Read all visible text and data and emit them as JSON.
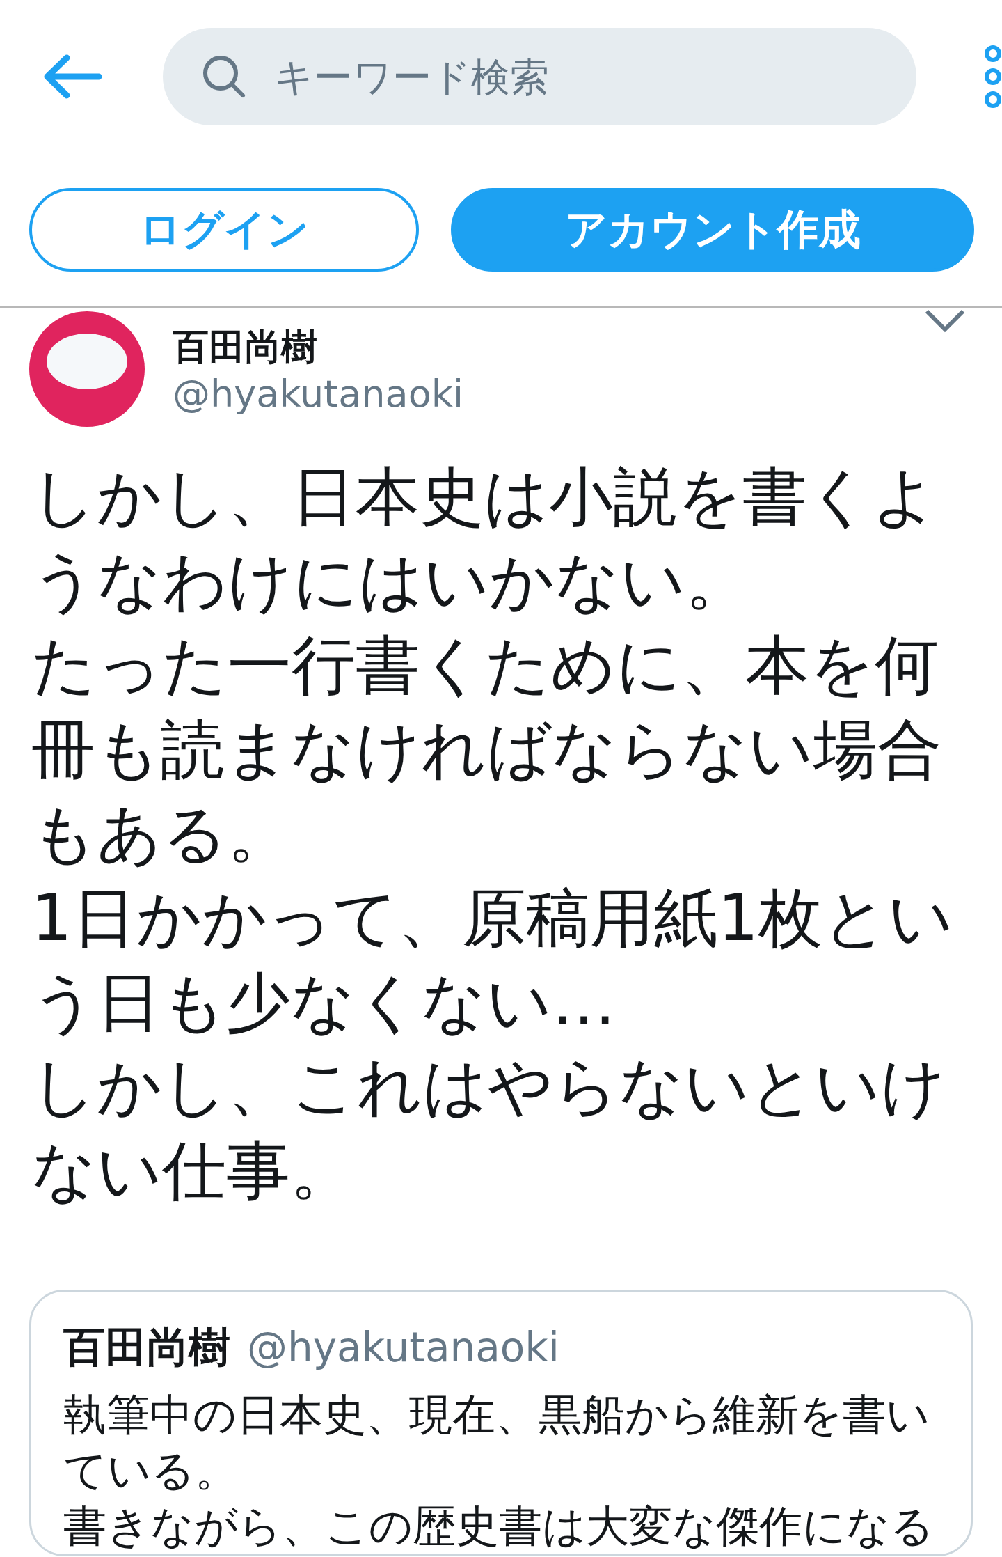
{
  "search": {
    "placeholder": "キーワード検索"
  },
  "buttons": [
    {
      "kind": "outline",
      "label": "ログイン"
    },
    {
      "kind": "filled",
      "label": "アカウント作成"
    }
  ],
  "tweet": {
    "name": "百田尚樹",
    "handle": "@hyakutanaoki",
    "paragraphs": [
      "しかし、日本史は小説を書くようなわけにはいかない。",
      "たった一行書くために、本を何冊も読まなければならない場合もある。",
      "1日かかって、原稿用紙1枚という日も少なくない…",
      "しかし、これはやらないといけない仕事。"
    ],
    "quote": {
      "name": "百田尚樹",
      "handle": "@hyakutanaoki",
      "paragraphs": [
        "執筆中の日本史、現在、黒船から維新を書いている。",
        "書きながら、この歴史書は大変な傑作になる"
      ]
    }
  }
}
